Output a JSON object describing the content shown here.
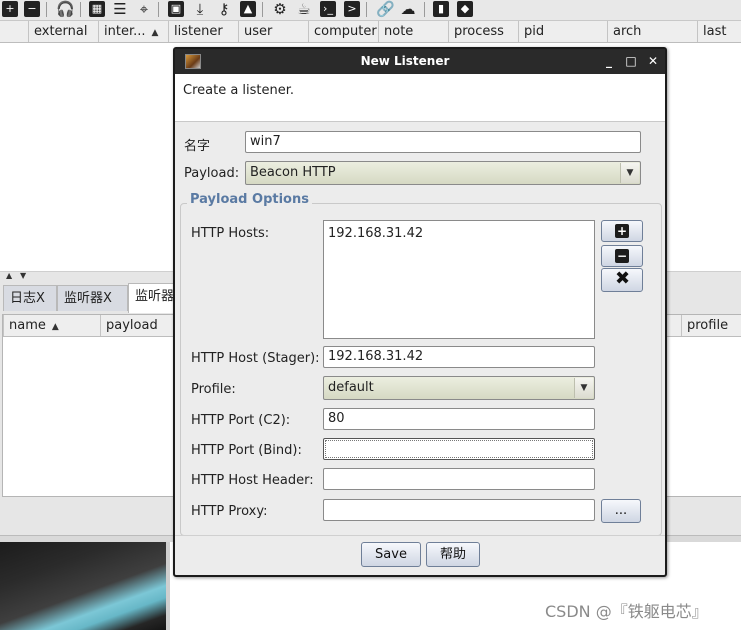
{
  "toolbar": {
    "icons": [
      "plus-icon",
      "minus-icon",
      "headphones-icon",
      "screenshot-icon",
      "list-icon",
      "target-icon",
      "image-icon",
      "download-icon",
      "key-icon",
      "picture-icon",
      "gear-icon",
      "coffee-icon",
      "terminal-icon",
      "link-icon",
      "cloud-icon",
      "book-icon",
      "package-icon"
    ]
  },
  "top_table": {
    "columns": [
      "external",
      "inter...",
      "listener",
      "user",
      "computer",
      "note",
      "process",
      "pid",
      "arch",
      "last"
    ],
    "sort_indicator": "▲"
  },
  "tabs": [
    "日志X",
    "监听器X",
    "监听器"
  ],
  "lower_table": {
    "columns": [
      "name",
      "payload",
      "profile"
    ],
    "sort_indicator": "▲"
  },
  "dialog": {
    "title": "New Listener",
    "window_controls": {
      "minimize": "_",
      "maximize": "□",
      "close": "✕"
    },
    "description": "Create a listener.",
    "name_label": "名字",
    "name_value": "win7",
    "payload_label": "Payload:",
    "payload_value": "Beacon HTTP",
    "options_title": "Payload Options",
    "hosts_label": "HTTP Hosts:",
    "hosts": [
      "192.168.31.42"
    ],
    "host_stager_label": "HTTP Host (Stager):",
    "host_stager_value": "192.168.31.42",
    "profile_label": "Profile:",
    "profile_value": "default",
    "port_c2_label": "HTTP Port (C2):",
    "port_c2_value": "80",
    "port_bind_label": "HTTP Port (Bind):",
    "port_bind_value": "",
    "host_header_label": "HTTP Host Header:",
    "host_header_value": "",
    "proxy_label": "HTTP Proxy:",
    "proxy_value": "",
    "proxy_button": "...",
    "save_label": "Save",
    "help_label": "帮助"
  },
  "watermark": "CSDN @『铁躯电芯』"
}
